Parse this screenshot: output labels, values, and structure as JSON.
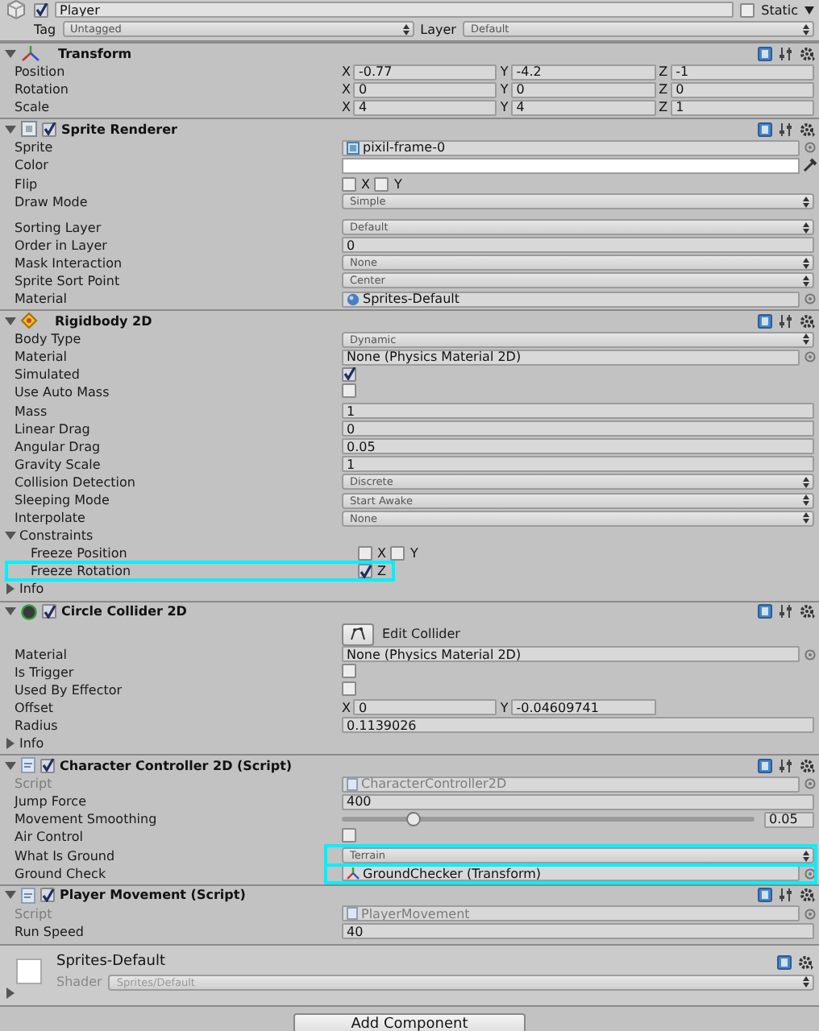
{
  "game_object": {
    "active": true,
    "name": "Player",
    "static_label": "Static",
    "static": false,
    "tag_label": "Tag",
    "tag": "Untagged",
    "layer_label": "Layer",
    "layer": "Default"
  },
  "components": [
    {
      "title": "Transform",
      "kind": "transform",
      "expanded": true,
      "rows": [
        {
          "kind": "vector",
          "label": "Position",
          "axes": [
            {
              "axis": "X",
              "value": "-0.77"
            },
            {
              "axis": "Y",
              "value": "-4.2"
            },
            {
              "axis": "Z",
              "value": "-1"
            }
          ]
        },
        {
          "kind": "vector",
          "label": "Rotation",
          "axes": [
            {
              "axis": "X",
              "value": "0"
            },
            {
              "axis": "Y",
              "value": "0"
            },
            {
              "axis": "Z",
              "value": "0"
            }
          ]
        },
        {
          "kind": "vector",
          "label": "Scale",
          "axes": [
            {
              "axis": "X",
              "value": "4"
            },
            {
              "axis": "Y",
              "value": "4"
            },
            {
              "axis": "Z",
              "value": "1"
            }
          ]
        }
      ]
    },
    {
      "title": "Sprite Renderer",
      "kind": "renderer",
      "enabled": true,
      "expanded": true,
      "rows": [
        {
          "kind": "sprite_ref",
          "label": "Sprite",
          "value": "pixil-frame-0"
        },
        {
          "kind": "color",
          "label": "Color",
          "color": "#ffffff"
        },
        {
          "kind": "checks",
          "label": "Flip",
          "checks": [
            {
              "label": "X",
              "checked": false
            },
            {
              "label": "Y",
              "checked": false
            }
          ]
        },
        {
          "kind": "dropdown",
          "label": "Draw Mode",
          "value": "Simple"
        },
        {
          "kind": "spacer"
        },
        {
          "kind": "dropdown",
          "label": "Sorting Layer",
          "value": "Default"
        },
        {
          "kind": "field",
          "label": "Order in Layer",
          "value": "0"
        },
        {
          "kind": "dropdown",
          "label": "Mask Interaction",
          "value": "None"
        },
        {
          "kind": "dropdown",
          "label": "Sprite Sort Point",
          "value": "Center"
        },
        {
          "kind": "material_ref",
          "label": "Material",
          "value": "Sprites-Default"
        }
      ]
    },
    {
      "title": "Rigidbody 2D",
      "kind": "rigidbody",
      "expanded": true,
      "rows": [
        {
          "kind": "dropdown",
          "label": "Body Type",
          "value": "Dynamic"
        },
        {
          "kind": "object",
          "label": "Material",
          "value": "None (Physics Material 2D)"
        },
        {
          "kind": "check",
          "label": "Simulated",
          "checked": true
        },
        {
          "kind": "check",
          "label": "Use Auto Mass",
          "checked": false
        },
        {
          "kind": "field",
          "label": "Mass",
          "value": "1"
        },
        {
          "kind": "field",
          "label": "Linear Drag",
          "value": "0"
        },
        {
          "kind": "field",
          "label": "Angular Drag",
          "value": "0.05"
        },
        {
          "kind": "field",
          "label": "Gravity Scale",
          "value": "1"
        },
        {
          "kind": "dropdown",
          "label": "Collision Detection",
          "value": "Discrete"
        },
        {
          "kind": "dropdown",
          "label": "Sleeping Mode",
          "value": "Start Awake"
        },
        {
          "kind": "dropdown",
          "label": "Interpolate",
          "value": "None"
        },
        {
          "kind": "foldout",
          "label": "Constraints",
          "expanded": true,
          "children": [
            {
              "kind": "checks",
              "label": "Freeze Position",
              "checks": [
                {
                  "label": "X",
                  "checked": false
                },
                {
                  "label": "Y",
                  "checked": false
                }
              ]
            },
            {
              "kind": "checks",
              "label": "Freeze Rotation",
              "highlighted": true,
              "checks": [
                {
                  "label": "Z",
                  "checked": true
                }
              ]
            }
          ]
        },
        {
          "kind": "foldout",
          "label": "Info",
          "expanded": false
        }
      ]
    },
    {
      "title": "Circle Collider 2D",
      "kind": "collider",
      "enabled": true,
      "expanded": true,
      "rows": [
        {
          "kind": "tool_button",
          "label": "Edit Collider"
        },
        {
          "kind": "object",
          "label": "Material",
          "value": "None (Physics Material 2D)"
        },
        {
          "kind": "check",
          "label": "Is Trigger",
          "checked": false
        },
        {
          "kind": "check",
          "label": "Used By Effector",
          "checked": false
        },
        {
          "kind": "vector",
          "label": "Offset",
          "axes": [
            {
              "axis": "X",
              "value": "0"
            },
            {
              "axis": "Y",
              "value": "-0.04609741"
            }
          ]
        },
        {
          "kind": "field",
          "label": "Radius",
          "value": "0.1139026"
        },
        {
          "kind": "foldout",
          "label": "Info",
          "expanded": false
        }
      ]
    },
    {
      "title": "Character Controller 2D (Script)",
      "kind": "script",
      "enabled": true,
      "expanded": true,
      "rows": [
        {
          "kind": "script_ref",
          "label": "Script",
          "value": "CharacterController2D",
          "disabled": true
        },
        {
          "kind": "field",
          "label": "Jump Force",
          "value": "400"
        },
        {
          "kind": "slider",
          "label": "Movement Smoothing",
          "level": 0.17,
          "value": "0.05"
        },
        {
          "kind": "check",
          "label": "Air Control",
          "checked": false
        },
        {
          "kind": "dropdown",
          "label": "What Is Ground",
          "value": "Terrain",
          "highlighted": true
        },
        {
          "kind": "transform_ref",
          "label": "Ground Check",
          "value": "GroundChecker (Transform)",
          "highlighted": true
        }
      ]
    },
    {
      "title": "Player Movement (Script)",
      "kind": "script",
      "enabled": true,
      "expanded": true,
      "rows": [
        {
          "kind": "script_ref",
          "label": "Script",
          "value": "PlayerMovement",
          "disabled": true
        },
        {
          "kind": "field",
          "label": "Run Speed",
          "value": "40"
        }
      ]
    }
  ],
  "material": {
    "name": "Sprites-Default",
    "shader_label": "Shader",
    "shader": "Sprites/Default",
    "expanded": false
  },
  "add_component": "Add Component"
}
